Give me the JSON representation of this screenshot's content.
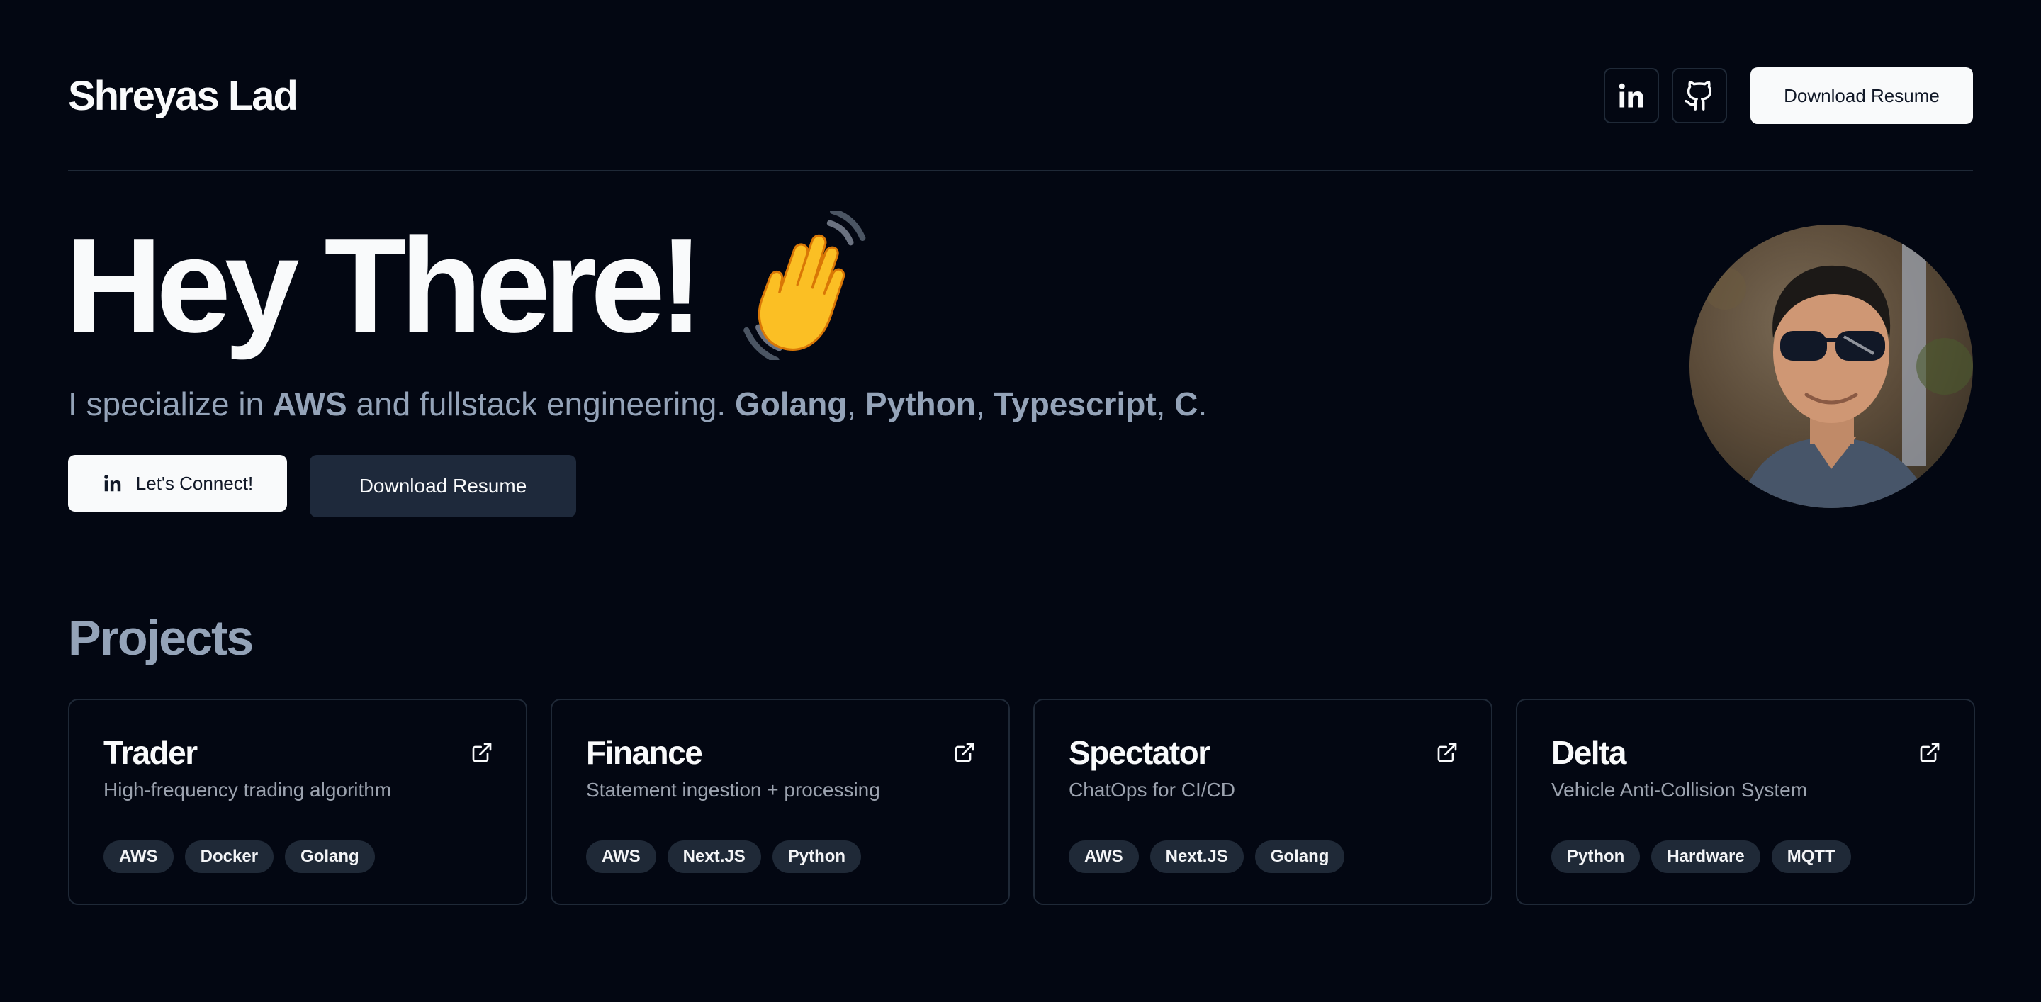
{
  "header": {
    "brand": "Shreyas Lad",
    "linkedin_icon": "linkedin-icon",
    "github_icon": "github-icon",
    "resume_label": "Download Resume"
  },
  "hero": {
    "title": "Hey There!",
    "emoji": "👋",
    "tagline": {
      "prefix": "I specialize in ",
      "aws": "AWS",
      "middle": " and fullstack engineering. ",
      "golang": "Golang",
      "sep1": ", ",
      "python": "Python",
      "sep2": ", ",
      "typescript": "Typescript",
      "sep3": ", ",
      "c": "C",
      "end": "."
    },
    "connect_label": "Let's Connect!",
    "resume_label": "Download Resume"
  },
  "projects": {
    "heading": "Projects",
    "items": [
      {
        "title": "Trader",
        "desc": "High-frequency trading algorithm",
        "tags": [
          "AWS",
          "Docker",
          "Golang"
        ]
      },
      {
        "title": "Finance",
        "desc": "Statement ingestion + processing",
        "tags": [
          "AWS",
          "Next.JS",
          "Python"
        ]
      },
      {
        "title": "Spectator",
        "desc": "ChatOps for CI/CD",
        "tags": [
          "AWS",
          "Next.JS",
          "Golang"
        ]
      },
      {
        "title": "Delta",
        "desc": "Vehicle Anti-Collision System",
        "tags": [
          "Python",
          "Hardware",
          "MQTT"
        ]
      }
    ]
  },
  "colors": {
    "background": "#030712",
    "muted": "#94a3b8",
    "tag_bg": "#1f2937",
    "dark_button": "#1e293b"
  }
}
